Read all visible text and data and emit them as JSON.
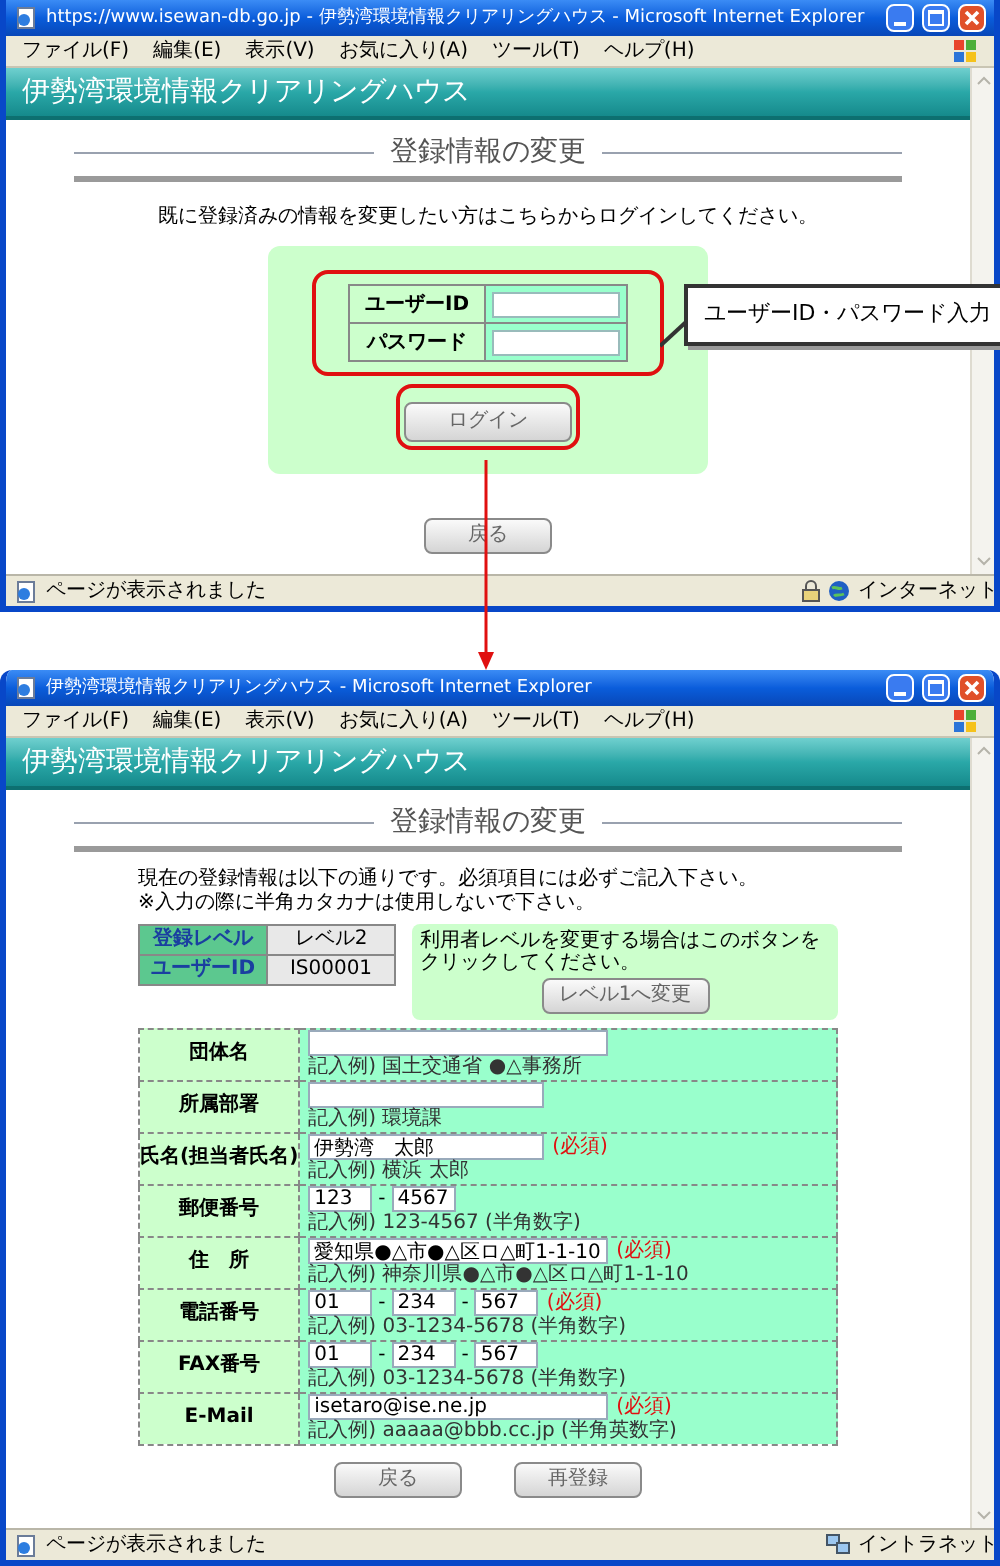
{
  "login_window": {
    "title": "https://www.isewan-db.go.jp - 伊勢湾環境情報クリアリングハウス - Microsoft Internet Explorer",
    "menu": [
      "ファイル(F)",
      "編集(E)",
      "表示(V)",
      "お気に入り(A)",
      "ツール(T)",
      "ヘルプ(H)"
    ],
    "site_title": "伊勢湾環境情報クリアリングハウス",
    "heading": "登録情報の変更",
    "intro": "既に登録済みの情報を変更したい方はこちらからログインしてください。",
    "login_fields": [
      {
        "label": "ユーザーID"
      },
      {
        "label": "パスワード"
      }
    ],
    "login_button": "ログイン",
    "back_button": "戻る",
    "status": "ページが表示されました",
    "zone": "インターネット"
  },
  "callout": "ユーザーID・パスワード入力",
  "edit_window": {
    "title": "伊勢湾環境情報クリアリングハウス - Microsoft Internet Explorer",
    "menu": [
      "ファイル(F)",
      "編集(E)",
      "表示(V)",
      "お気に入り(A)",
      "ツール(T)",
      "ヘルプ(H)"
    ],
    "site_title": "伊勢湾環境情報クリアリングハウス",
    "heading": "登録情報の変更",
    "notes": [
      "現在の登録情報は以下の通りです。必須項目には必ずご記入下さい。",
      "※入力の際に半角カタカナは使用しないで下さい。"
    ],
    "account": [
      {
        "label": "登録レベル",
        "value": "レベル2"
      },
      {
        "label": "ユーザーID",
        "value": "IS00001"
      }
    ],
    "level_box": {
      "text": "利用者レベルを変更する場合はこのボタンをクリックしてください。",
      "button": "レベル1へ変更"
    },
    "form": [
      {
        "label": "団体名",
        "kind": "long",
        "hint": "記入例) 国土交通省 ●△事務所"
      },
      {
        "label": "所属部署",
        "kind": "medium",
        "hint": "記入例) 環境課"
      },
      {
        "label": "氏名(担当者氏名)",
        "kind": "medium",
        "value": "伊勢湾　太郎",
        "required_mark": "(必須)",
        "hint": "記入例) 横浜 太郎"
      },
      {
        "label": "郵便番号",
        "kind": "split",
        "parts": [
          "123",
          "4567"
        ],
        "separator": "-",
        "hint": "記入例) 123-4567 (半角数字)"
      },
      {
        "label": "住　所",
        "kind": "long",
        "value": "愛知県●△市●△区ロ△町1-1-10",
        "required_mark": "(必須)",
        "hint": "記入例) 神奈川県●△市●△区ロ△町1-1-10"
      },
      {
        "label": "電話番号",
        "kind": "split",
        "parts": [
          "01",
          "234",
          "567"
        ],
        "separator": "-",
        "required_mark": "(必須)",
        "hint": "記入例) 03-1234-5678 (半角数字)"
      },
      {
        "label": "FAX番号",
        "kind": "split",
        "parts": [
          "01",
          "234",
          "567"
        ],
        "separator": "-",
        "hint": "記入例) 03-1234-5678 (半角数字)"
      },
      {
        "label": "E-Mail",
        "kind": "long",
        "value": "isetaro@ise.ne.jp",
        "required_mark": "(必須)",
        "hint": "記入例) aaaaa@bbb.cc.jp (半角英数字)"
      }
    ],
    "buttons": [
      "戻る",
      "再登録"
    ],
    "status": "ページが表示されました",
    "zone": "イントラネット"
  }
}
